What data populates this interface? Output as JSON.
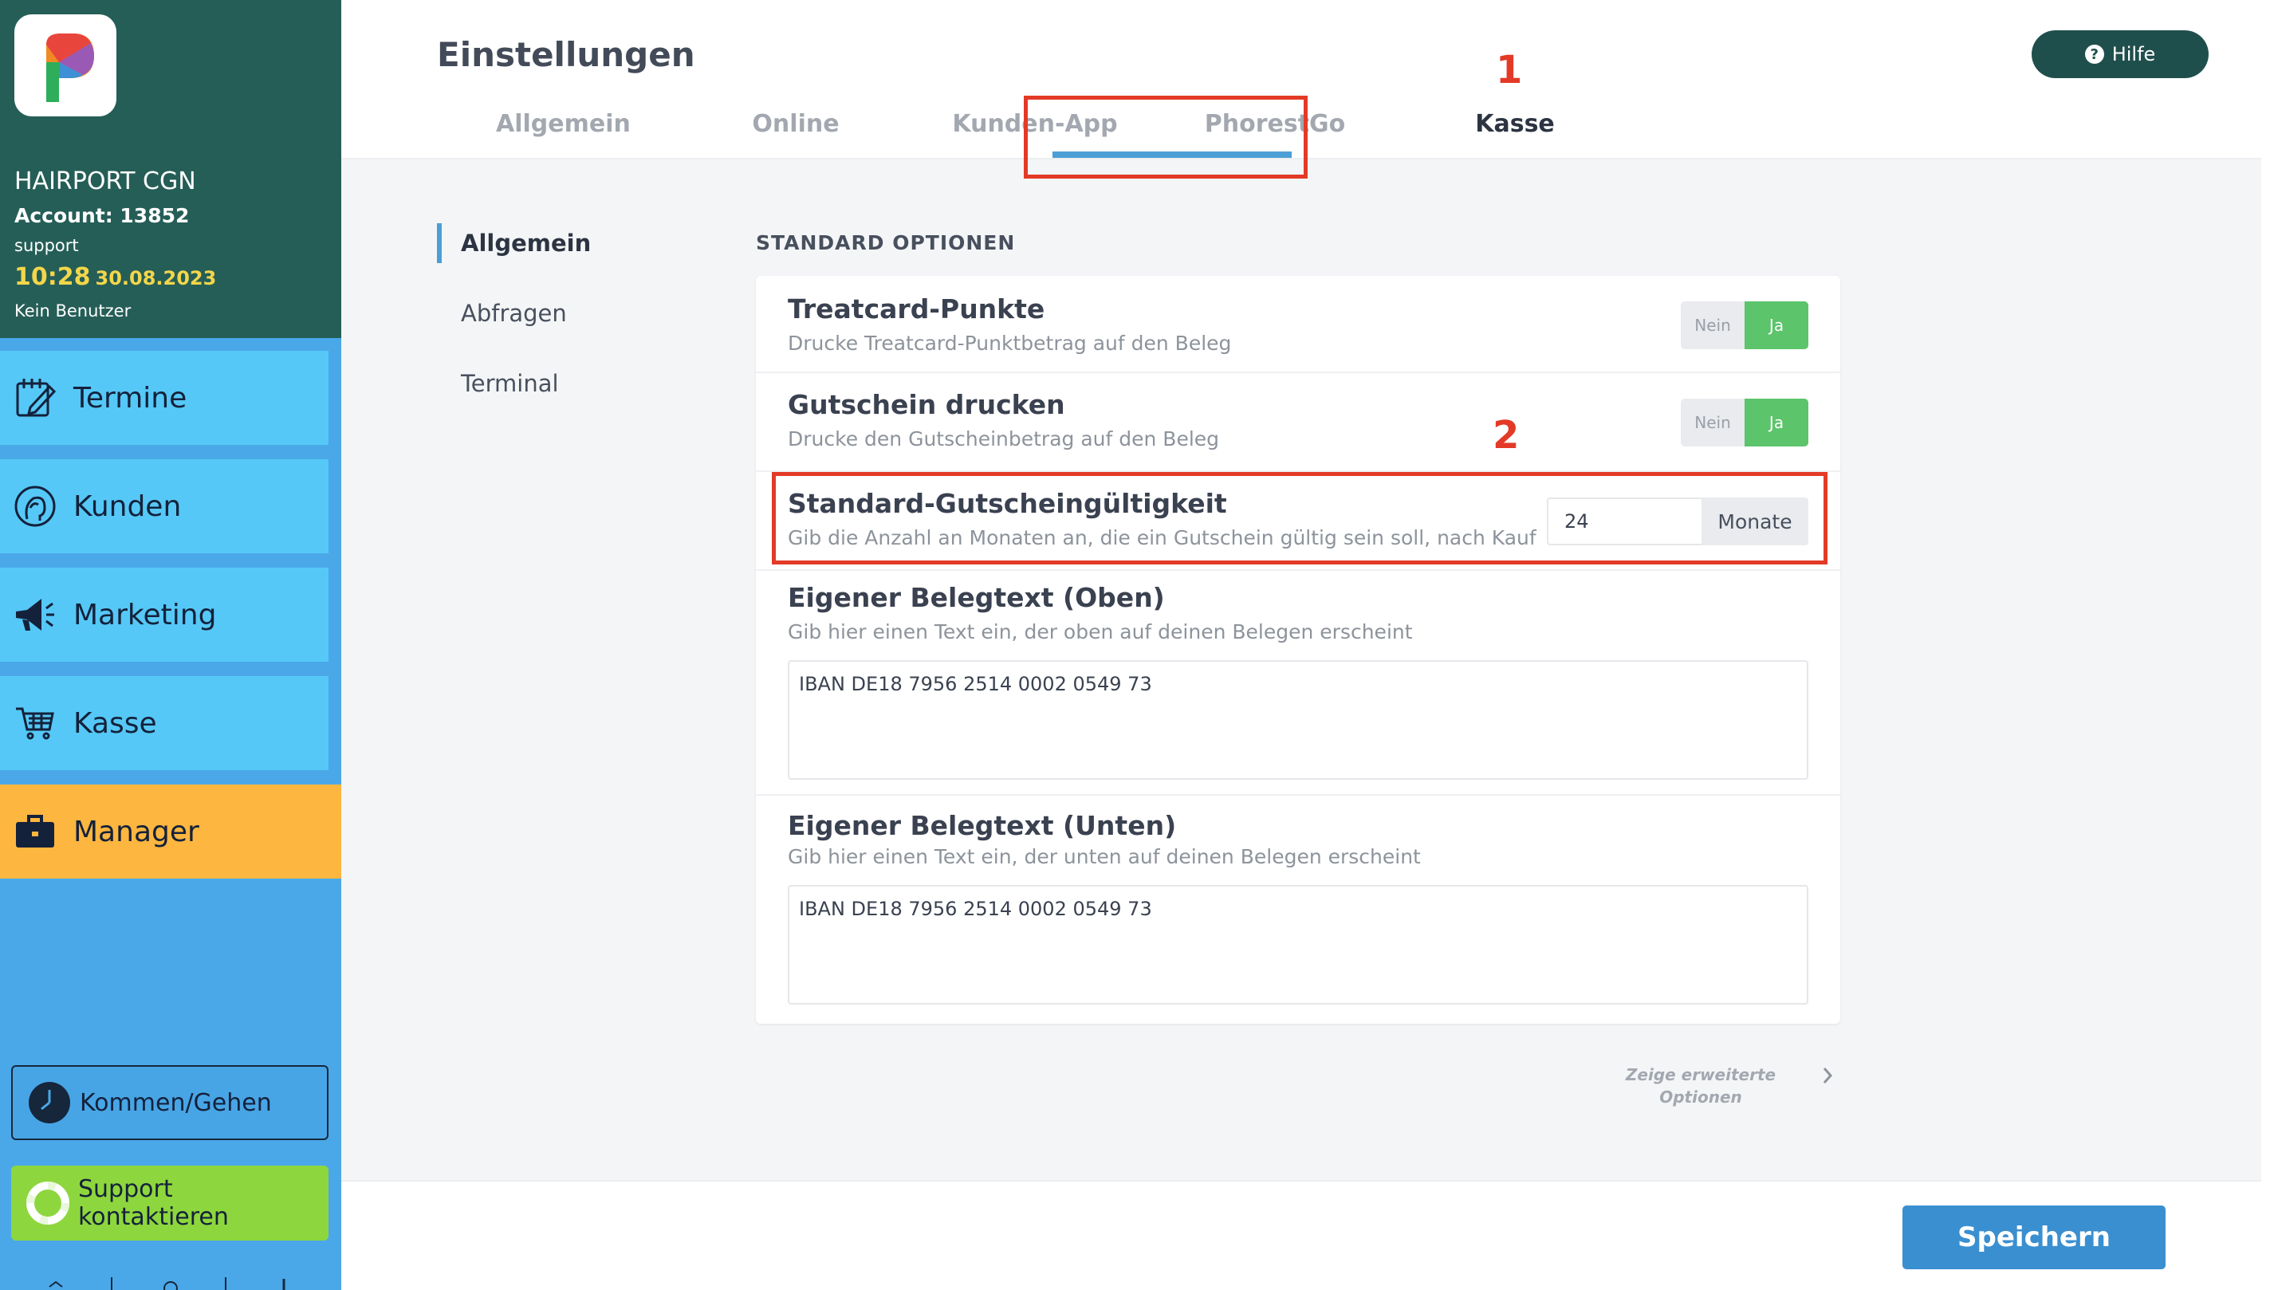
{
  "sidebar": {
    "salon_name": "HAIRPORT CGN",
    "account": "Account: 13852",
    "user_role": "support",
    "time": "10:28",
    "date": "30.08.2023",
    "no_user": "Kein Benutzer",
    "nav": [
      {
        "label": "Termine",
        "icon": "calendar-edit-icon"
      },
      {
        "label": "Kunden",
        "icon": "customer-head-icon"
      },
      {
        "label": "Marketing",
        "icon": "megaphone-icon"
      },
      {
        "label": "Kasse",
        "icon": "shopping-cart-icon"
      },
      {
        "label": "Manager",
        "icon": "briefcase-icon"
      }
    ],
    "kommen_gehen": "Kommen/Gehen",
    "support": "Support kontaktieren"
  },
  "header": {
    "title": "Einstellungen",
    "help": "Hilfe",
    "tabs": [
      "Allgemein",
      "Online",
      "Kunden-App",
      "PhorestGo",
      "Kasse"
    ],
    "active_tab": "Kasse"
  },
  "annotations": {
    "one": "1",
    "two": "2"
  },
  "subnav": {
    "items": [
      "Allgemein",
      "Abfragen",
      "Terminal"
    ],
    "active": "Allgemein"
  },
  "section": {
    "heading": "STANDARD OPTIONEN",
    "rows": {
      "treatcard": {
        "title": "Treatcard-Punkte",
        "desc": "Drucke Treatcard-Punktbetrag auf den Beleg",
        "off": "Nein",
        "on": "Ja"
      },
      "gutschein": {
        "title": "Gutschein drucken",
        "desc": "Drucke den Gutscheinbetrag auf den Beleg",
        "off": "Nein",
        "on": "Ja"
      },
      "validity": {
        "title": "Standard-Gutscheingültigkeit",
        "desc": "Gib die Anzahl an Monaten an, die ein Gutschein gültig sein soll, nach Kauf",
        "value": "24",
        "unit": "Monate"
      },
      "receipt_top": {
        "title": "Eigener Belegtext (Oben)",
        "desc": "Gib hier einen Text ein, der oben auf deinen Belegen erscheint",
        "value": "IBAN DE18 7956 2514 0002 0549 73"
      },
      "receipt_bottom": {
        "title": "Eigener Belegtext (Unten)",
        "desc": "Gib hier einen Text ein, der unten auf deinen Belegen erscheint",
        "value": "IBAN DE18 7956 2514 0002 0549 73"
      }
    }
  },
  "more_options_line1": "Zeige erweiterte",
  "more_options_line2": "Optionen",
  "save": "Speichern",
  "colors": {
    "sidebar_head": "#255e57",
    "nav_item": "#55c8f7",
    "nav_active": "#fdb63f",
    "accent_blue": "#3a8fd0",
    "toggle_on": "#5cc46b",
    "annotation_red": "#e33a27"
  }
}
